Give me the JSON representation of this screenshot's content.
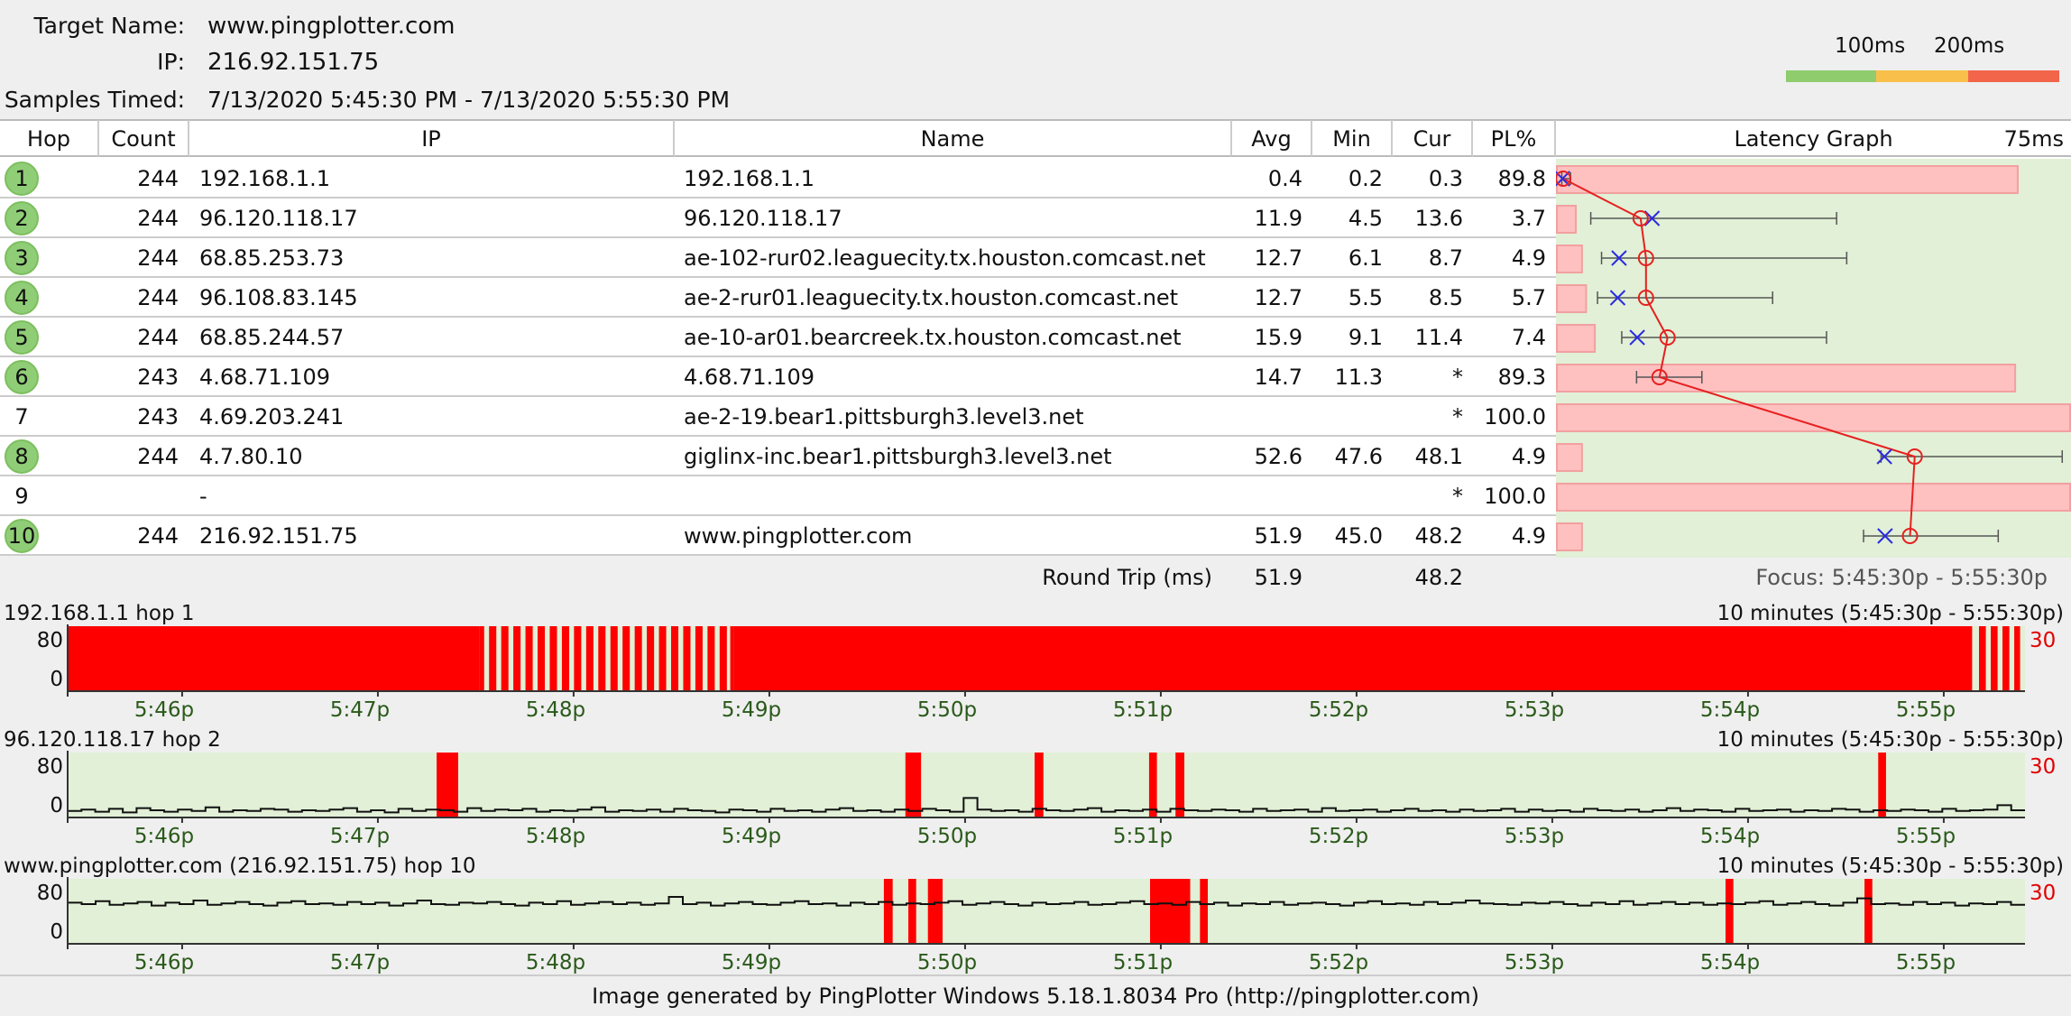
{
  "header": {
    "target_label": "Target Name:",
    "target_value": "www.pingplotter.com",
    "ip_label": "IP:",
    "ip_value": "216.92.151.75",
    "samples_label": "Samples Timed:",
    "samples_value": "7/13/2020 5:45:30 PM - 7/13/2020 5:55:30 PM",
    "scale_100": "100ms",
    "scale_200": "200ms",
    "scale_colors": [
      "#8fcc6e",
      "#f8c04a",
      "#f2654b"
    ]
  },
  "columns": {
    "hop": "Hop",
    "count": "Count",
    "ip": "IP",
    "name": "Name",
    "avg": "Avg",
    "min": "Min",
    "cur": "Cur",
    "pl": "PL%",
    "graph": "Latency Graph",
    "graph_scale": "75ms"
  },
  "rows": [
    {
      "hop": "1",
      "count": "244",
      "ip": "192.168.1.1",
      "name": "192.168.1.1",
      "avg": "0.4",
      "min": "0.2",
      "cur": "0.3",
      "pl": "89.8",
      "ok": true
    },
    {
      "hop": "2",
      "count": "244",
      "ip": "96.120.118.17",
      "name": "96.120.118.17",
      "avg": "11.9",
      "min": "4.5",
      "cur": "13.6",
      "pl": "3.7",
      "ok": true
    },
    {
      "hop": "3",
      "count": "244",
      "ip": "68.85.253.73",
      "name": "ae-102-rur02.leaguecity.tx.houston.comcast.net",
      "avg": "12.7",
      "min": "6.1",
      "cur": "8.7",
      "pl": "4.9",
      "ok": true
    },
    {
      "hop": "4",
      "count": "244",
      "ip": "96.108.83.145",
      "name": "ae-2-rur01.leaguecity.tx.houston.comcast.net",
      "avg": "12.7",
      "min": "5.5",
      "cur": "8.5",
      "pl": "5.7",
      "ok": true
    },
    {
      "hop": "5",
      "count": "244",
      "ip": "68.85.244.57",
      "name": "ae-10-ar01.bearcreek.tx.houston.comcast.net",
      "avg": "15.9",
      "min": "9.1",
      "cur": "11.4",
      "pl": "7.4",
      "ok": true
    },
    {
      "hop": "6",
      "count": "243",
      "ip": "4.68.71.109",
      "name": "4.68.71.109",
      "avg": "14.7",
      "min": "11.3",
      "cur": "*",
      "pl": "89.3",
      "ok": true
    },
    {
      "hop": "7",
      "count": "243",
      "ip": "4.69.203.241",
      "name": "ae-2-19.bear1.pittsburgh3.level3.net",
      "avg": "",
      "min": "",
      "cur": "*",
      "pl": "100.0",
      "ok": false
    },
    {
      "hop": "8",
      "count": "244",
      "ip": "4.7.80.10",
      "name": "giglinx-inc.bear1.pittsburgh3.level3.net",
      "avg": "52.6",
      "min": "47.6",
      "cur": "48.1",
      "pl": "4.9",
      "ok": true
    },
    {
      "hop": "9",
      "count": "",
      "ip": "-",
      "name": "",
      "avg": "",
      "min": "",
      "cur": "*",
      "pl": "100.0",
      "ok": false
    },
    {
      "hop": "10",
      "count": "244",
      "ip": "216.92.151.75",
      "name": "www.pingplotter.com",
      "avg": "51.9",
      "min": "45.0",
      "cur": "48.2",
      "pl": "4.9",
      "ok": true
    }
  ],
  "latency_graph": {
    "scale_max_ms": 75,
    "points": [
      {
        "hop": 1,
        "avg": 0.4,
        "min": 0.2,
        "max": 1.5,
        "cur": 0.3,
        "pl": 89.8
      },
      {
        "hop": 2,
        "avg": 11.9,
        "min": 4.5,
        "max": 41,
        "cur": 13.6,
        "pl": 3.7
      },
      {
        "hop": 3,
        "avg": 12.7,
        "min": 6.1,
        "max": 42.5,
        "cur": 8.7,
        "pl": 4.9
      },
      {
        "hop": 4,
        "avg": 12.7,
        "min": 5.5,
        "max": 31.5,
        "cur": 8.5,
        "pl": 5.7
      },
      {
        "hop": 5,
        "avg": 15.9,
        "min": 9.1,
        "max": 39.5,
        "cur": 11.4,
        "pl": 7.4
      },
      {
        "hop": 6,
        "avg": 14.7,
        "min": 11.3,
        "max": 21,
        "cur": null,
        "pl": 89.3
      },
      {
        "hop": 7,
        "avg": null,
        "min": null,
        "max": null,
        "cur": null,
        "pl": 100.0
      },
      {
        "hop": 8,
        "avg": 52.6,
        "min": 47.6,
        "max": 74.5,
        "cur": 48.1,
        "pl": 4.9
      },
      {
        "hop": 9,
        "avg": null,
        "min": null,
        "max": null,
        "cur": null,
        "pl": 100.0
      },
      {
        "hop": 10,
        "avg": 51.9,
        "min": 45.0,
        "max": 65,
        "cur": 48.2,
        "pl": 4.9
      }
    ]
  },
  "summary": {
    "label": "Round Trip (ms)",
    "avg": "51.9",
    "cur": "48.2",
    "focus": "Focus: 5:45:30p - 5:55:30p"
  },
  "timeline_graphs": [
    {
      "title": "192.168.1.1 hop 1",
      "range": "10 minutes (5:45:30p - 5:55:30p)",
      "y_max": "80",
      "y_min": "0",
      "scale": "30",
      "loss_bars": [
        [
          0,
          0.2103
        ],
        [
          0.2103,
          0.2128
        ],
        [
          0.2153,
          0.219
        ],
        [
          0.2215,
          0.2252
        ],
        [
          0.2277,
          0.2314
        ],
        [
          0.2339,
          0.2376
        ],
        [
          0.2401,
          0.2438
        ],
        [
          0.2463,
          0.25
        ],
        [
          0.2525,
          0.2562
        ],
        [
          0.2587,
          0.2624
        ],
        [
          0.2649,
          0.2686
        ],
        [
          0.2711,
          0.2748
        ],
        [
          0.2773,
          0.281
        ],
        [
          0.2835,
          0.2872
        ],
        [
          0.2897,
          0.2934
        ],
        [
          0.2959,
          0.2996
        ],
        [
          0.3021,
          0.3058
        ],
        [
          0.3083,
          0.312
        ],
        [
          0.3145,
          0.3182
        ],
        [
          0.3207,
          0.3244
        ],
        [
          0.3269,
          0.3306
        ],
        [
          0.3331,
          0.3368
        ],
        [
          0.3385,
          0.3405
        ],
        [
          0.3405,
          0.973
        ],
        [
          0.9765,
          0.98
        ],
        [
          0.9825,
          0.986
        ],
        [
          0.9885,
          0.992
        ],
        [
          0.9945,
          0.9975
        ]
      ],
      "latency": []
    },
    {
      "title": "96.120.118.17 hop 2",
      "range": "10 minutes (5:45:30p - 5:55:30p)",
      "y_max": "80",
      "y_min": "0",
      "scale": "30",
      "loss_bars": [
        [
          0.1885,
          0.1995
        ],
        [
          0.428,
          0.436
        ],
        [
          0.494,
          0.4985
        ],
        [
          0.5525,
          0.5565
        ],
        [
          0.566,
          0.5705
        ],
        [
          0.925,
          0.929
        ]
      ],
      "latency": [
        4,
        6,
        3,
        7,
        2,
        8,
        5,
        3,
        6,
        4,
        9,
        3,
        5,
        4,
        7,
        6,
        3,
        5,
        4,
        6,
        8,
        3,
        5,
        2,
        7,
        4,
        6,
        5,
        3,
        8,
        4,
        6,
        5,
        7,
        3,
        5,
        4,
        6,
        9,
        3,
        5,
        4,
        6,
        3,
        7,
        5,
        4,
        2,
        6,
        5,
        3,
        7,
        4,
        5,
        3,
        6,
        8,
        4,
        5,
        3,
        6,
        4,
        7,
        5,
        3,
        22,
        6,
        4,
        5,
        3,
        7,
        5,
        4,
        6,
        8,
        3,
        5,
        4,
        6,
        3,
        7,
        5,
        4,
        6,
        5,
        3,
        7,
        4,
        5,
        6,
        3,
        8,
        4,
        5,
        6,
        3,
        5,
        7,
        4,
        5,
        3,
        6,
        4,
        5,
        7,
        3,
        6,
        4,
        5,
        3,
        7,
        5,
        4,
        6,
        3,
        5,
        8,
        4,
        6,
        5,
        3,
        7,
        4,
        5,
        6,
        3,
        5,
        4,
        7,
        6,
        3,
        5,
        4,
        6,
        5,
        3,
        7,
        4,
        5,
        6,
        12,
        5
      ]
    },
    {
      "title": "www.pingplotter.com (216.92.151.75) hop 10",
      "range": "10 minutes (5:45:30p - 5:55:30p)",
      "y_max": "80",
      "y_min": "0",
      "scale": "30",
      "loss_bars": [
        [
          0.417,
          0.4215
        ],
        [
          0.4295,
          0.4335
        ],
        [
          0.4395,
          0.447
        ],
        [
          0.553,
          0.5735
        ],
        [
          0.5785,
          0.5825
        ],
        [
          0.847,
          0.851
        ],
        [
          0.918,
          0.922
        ]
      ],
      "latency": [
        52,
        50,
        54,
        49,
        51,
        53,
        48,
        52,
        50,
        55,
        49,
        51,
        53,
        50,
        48,
        52,
        54,
        50,
        51,
        49,
        53,
        50,
        52,
        48,
        51,
        55,
        50,
        49,
        52,
        51,
        53,
        50,
        48,
        52,
        50,
        54,
        49,
        51,
        53,
        50,
        52,
        49,
        51,
        60,
        50,
        52,
        48,
        51,
        53,
        50,
        49,
        52,
        54,
        50,
        51,
        48,
        52,
        50,
        53,
        49,
        51,
        50,
        52,
        54,
        49,
        51,
        53,
        50,
        48,
        52,
        50,
        51,
        53,
        49,
        50,
        52,
        54,
        50,
        51,
        49,
        53,
        50,
        52,
        48,
        51,
        50,
        53,
        49,
        51,
        52,
        50,
        48,
        52,
        54,
        50,
        51,
        49,
        53,
        50,
        52,
        55,
        51,
        50,
        49,
        52,
        51,
        53,
        50,
        48,
        52,
        50,
        54,
        49,
        51,
        53,
        50,
        52,
        49,
        51,
        50,
        52,
        54,
        49,
        51,
        53,
        50,
        48,
        52,
        58,
        50,
        51,
        49,
        53,
        50,
        52,
        48,
        51,
        50,
        53,
        49
      ]
    }
  ],
  "time_ticks": [
    "5:46p",
    "5:47p",
    "5:48p",
    "5:49p",
    "5:50p",
    "5:51p",
    "5:52p",
    "5:53p",
    "5:54p",
    "5:55p"
  ],
  "footer": "Image generated by PingPlotter Windows 5.18.1.8034 Pro (http://pingplotter.com)"
}
